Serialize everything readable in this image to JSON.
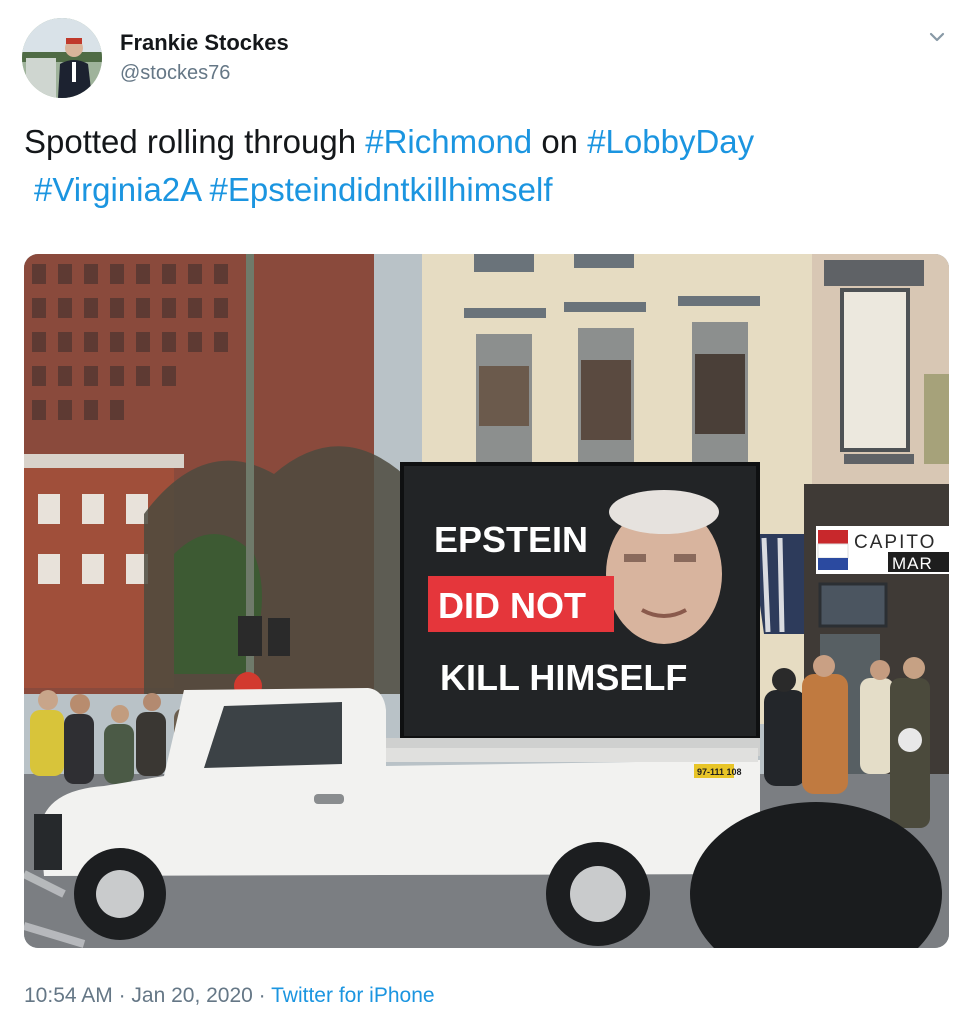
{
  "tweet": {
    "author": {
      "display_name": "Frankie Stockes",
      "handle": "@stockes76"
    },
    "text": {
      "prefix": "Spotted rolling through ",
      "hashtag_1": "#Richmond",
      "middle": " on ",
      "hashtag_2": "#LobbyDay",
      "hashtag_3": "#Virginia2A",
      "hashtag_4": "#Epsteindidntkillhimself"
    },
    "media": {
      "sign_line_1": "EPSTEIN",
      "sign_line_2": "DID NOT",
      "sign_line_3": "KILL HIMSELF",
      "store_sign_1": "CAPITO",
      "store_sign_2": "MAR",
      "plate": "97-111 108"
    },
    "footer": {
      "time": "10:54 AM",
      "separator_1": " · ",
      "date": "Jan 20, 2020",
      "separator_2": " · ",
      "source": "Twitter for iPhone"
    }
  },
  "colors": {
    "hashtag": "#1b95e0",
    "sign_red": "#e5363b",
    "truck_white": "#f2f2f0"
  },
  "icons": {
    "caret": "chevron-down-icon"
  }
}
